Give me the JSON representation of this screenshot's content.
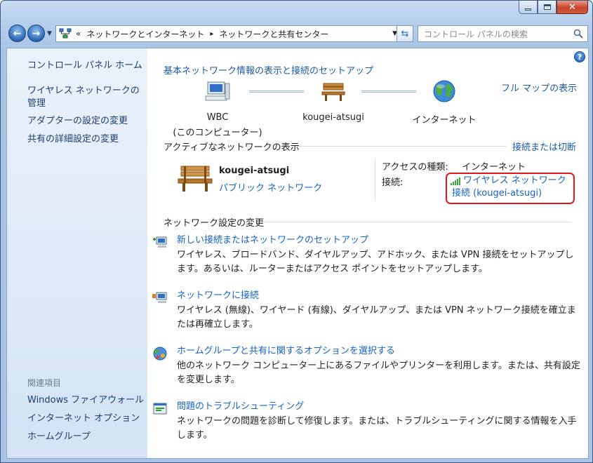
{
  "window": {
    "buttons": {
      "minimize": "minimize",
      "maximize": "maximize",
      "close": "close"
    }
  },
  "nav": {
    "breadcrumb_prefix": "«",
    "breadcrumbs": [
      "ネットワークとインターネット",
      "ネットワークと共有センター"
    ],
    "breadcrumb_sep": "▸",
    "search_placeholder": "コントロール パネルの検索"
  },
  "sidebar": {
    "home": "コントロール パネル ホーム",
    "items": [
      "ワイヤレス ネットワークの管理",
      "アダプターの設定の変更",
      "共有の詳細設定の変更"
    ],
    "related_heading": "関連項目",
    "related": [
      "Windows ファイアウォール",
      "インターネット オプション",
      "ホームグループ"
    ]
  },
  "main": {
    "heading": "基本ネットワーク情報の表示と接続のセットアップ",
    "full_map": "フル マップの表示",
    "nodes": [
      {
        "line1": "WBC",
        "line2": "(このコンピューター)"
      },
      {
        "line1": "kougei-atsugi",
        "line2": ""
      },
      {
        "line1": "インターネット",
        "line2": ""
      }
    ],
    "active_title": "アクティブなネットワークの表示",
    "connect_disconnect": "接続または切断",
    "network": {
      "name": "kougei-atsugi",
      "type": "パブリック ネットワーク",
      "access_label": "アクセスの種類:",
      "access_value": "インターネット",
      "conn_label": "接続:",
      "conn_value": "ワイヤレス ネットワーク接続 (kougei-atsugi)"
    },
    "change_title": "ネットワーク設定の変更",
    "tasks": [
      {
        "title": "新しい接続またはネットワークのセットアップ",
        "desc": "ワイヤレス、ブロードバンド、ダイヤルアップ、アドホック、または VPN 接続をセットアップします。あるいは、ルーターまたはアクセス ポイントをセットアップします。"
      },
      {
        "title": "ネットワークに接続",
        "desc": "ワイヤレス (無線)、ワイヤード (有線)、ダイヤルアップ、または VPN ネットワーク接続を確立または再確立します。"
      },
      {
        "title": "ホームグループと共有に関するオプションを選択する",
        "desc": "他のネットワーク コンピューター上にあるファイルやプリンターを利用します。または、共有設定を変更します。"
      },
      {
        "title": "問題のトラブルシューティング",
        "desc": "ネットワークの問題を診断して修復します。または、トラブルシューティングに関する情報を入手します。"
      }
    ]
  },
  "colors": {
    "link": "#1563c7",
    "highlight": "#e0171c",
    "sidebar_bg": "#dce9f7"
  }
}
